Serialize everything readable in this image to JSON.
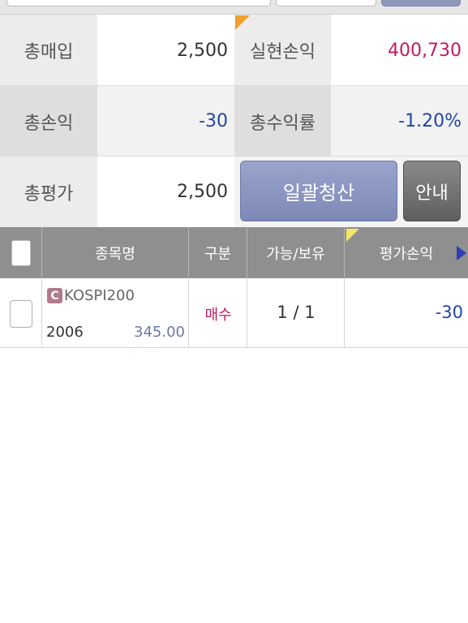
{
  "summary": {
    "total_purchase_label": "총매입",
    "total_purchase_value": "2,500",
    "realized_pl_label": "실현손익",
    "realized_pl_value": "400,730",
    "total_pl_label": "총손익",
    "total_pl_value": "-30",
    "total_return_label": "총수익률",
    "total_return_value": "-1.20%",
    "total_eval_label": "총평가",
    "total_eval_value": "2,500"
  },
  "buttons": {
    "liquidate_all": "일괄청산",
    "guide": "안내"
  },
  "table": {
    "headers": {
      "name": "종목명",
      "type": "구분",
      "avail_hold": "가능/보유",
      "eval_pl": "평가손익"
    },
    "rows": [
      {
        "badge": "C",
        "name": "KOSPI200",
        "code": "2006",
        "price": "345.00",
        "type": "매수",
        "avail_hold": "1 / 1",
        "eval_pl": "-30"
      }
    ]
  },
  "colors": {
    "negative": "#2244a6",
    "positive": "#c21a64",
    "primary_button": "#8e98bd",
    "header_bg": "#8f8f8f"
  }
}
